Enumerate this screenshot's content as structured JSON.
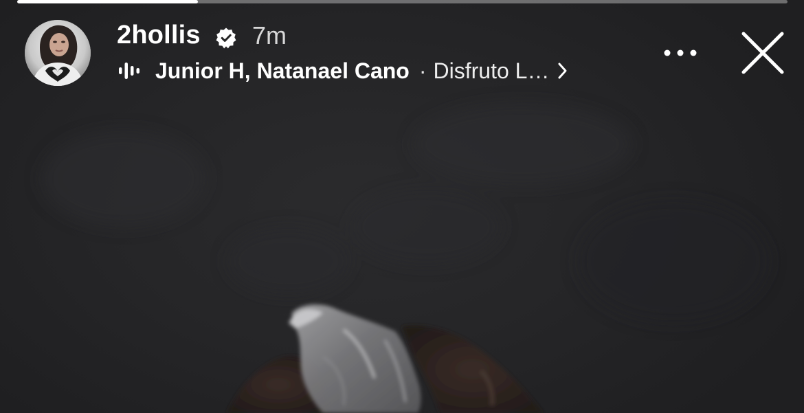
{
  "story": {
    "progress_fraction": 0.235,
    "user": {
      "username": "2hollis",
      "verified": true,
      "time_ago": "7m",
      "avatar_icon": "profile-avatar"
    },
    "music": {
      "icon": "audio-bars-icon",
      "artists": "Junior H, Natanael Cano",
      "separator": "·",
      "song_title": "Disfruto L…"
    },
    "actions": {
      "more_icon": "more-dots-icon",
      "close_icon": "close-icon"
    }
  },
  "colors": {
    "background": "#262626",
    "text": "#ffffff",
    "progress_fill": "#ffffff",
    "progress_track": "rgba(255,255,255,0.35)"
  }
}
